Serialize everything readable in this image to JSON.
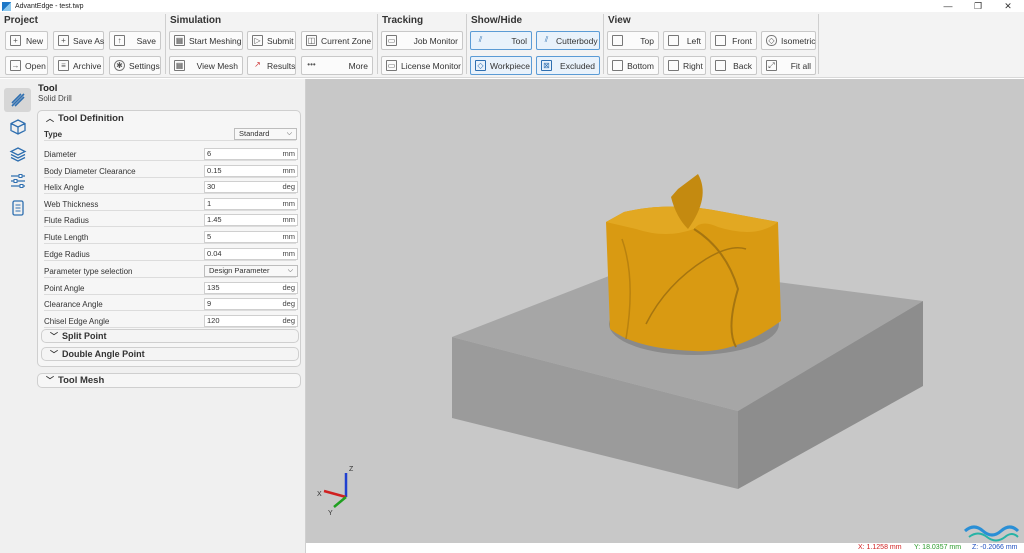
{
  "window": {
    "title": "AdvantEdge - test.twp",
    "minimize": "—",
    "maximize": "❐",
    "close": "✕"
  },
  "ribbon": {
    "project": {
      "title": "Project",
      "new": "New",
      "save_as": "Save As",
      "save": "Save",
      "open": "Open",
      "archive": "Archive",
      "settings": "Settings"
    },
    "simulation": {
      "title": "Simulation",
      "start_meshing": "Start Meshing",
      "submit": "Submit",
      "current_zone": "Current Zone",
      "view_mesh": "View Mesh",
      "results": "Results",
      "more": "More"
    },
    "tracking": {
      "title": "Tracking",
      "job_monitor": "Job Monitor",
      "license_monitor": "License Monitor"
    },
    "show_hide": {
      "title": "Show/Hide",
      "tool": "Tool",
      "cutterbody": "Cutterbody",
      "workpiece": "Workpiece",
      "excluded": "Excluded"
    },
    "view": {
      "title": "View",
      "top": "Top",
      "left": "Left",
      "front": "Front",
      "isometric": "Isometric",
      "bottom": "Bottom",
      "right": "Right",
      "back": "Back",
      "fit_all": "Fit all"
    }
  },
  "panel": {
    "title": "Tool",
    "subtitle": "Solid Drill",
    "tool_definition": {
      "header": "Tool Definition",
      "type_label": "Type",
      "type_value": "Standard",
      "params": [
        {
          "label": "Diameter",
          "value": "6",
          "unit": "mm"
        },
        {
          "label": "Body Diameter Clearance",
          "value": "0.15",
          "unit": "mm"
        },
        {
          "label": "Helix Angle",
          "value": "30",
          "unit": "deg"
        },
        {
          "label": "Web Thickness",
          "value": "1",
          "unit": "mm"
        },
        {
          "label": "Flute Radius",
          "value": "1.45",
          "unit": "mm"
        },
        {
          "label": "Flute Length",
          "value": "5",
          "unit": "mm"
        },
        {
          "label": "Edge Radius",
          "value": "0.04",
          "unit": "mm"
        }
      ],
      "param_type_label": "Parameter type selection",
      "param_type_value": "Design Parameter",
      "params2": [
        {
          "label": "Point Angle",
          "value": "135",
          "unit": "deg"
        },
        {
          "label": "Clearance Angle",
          "value": "9",
          "unit": "deg"
        },
        {
          "label": "Chisel Edge Angle",
          "value": "120",
          "unit": "deg"
        }
      ],
      "split_point": "Split Point",
      "double_angle_point": "Double Angle Point"
    },
    "tool_mesh": "Tool Mesh"
  },
  "axes": {
    "x": "X",
    "y": "Y",
    "z": "Z"
  },
  "status": {
    "x": "X: 1.1258 mm",
    "y": "Y: 18.0357 mm",
    "z": "Z: -0.2066 mm"
  },
  "colors": {
    "drill": "#d99a12",
    "block": "#9a9a9a",
    "active_border": "#5b9bd5",
    "status_x": "#d02020",
    "status_y": "#2a9a2a",
    "status_z": "#2050c0"
  }
}
